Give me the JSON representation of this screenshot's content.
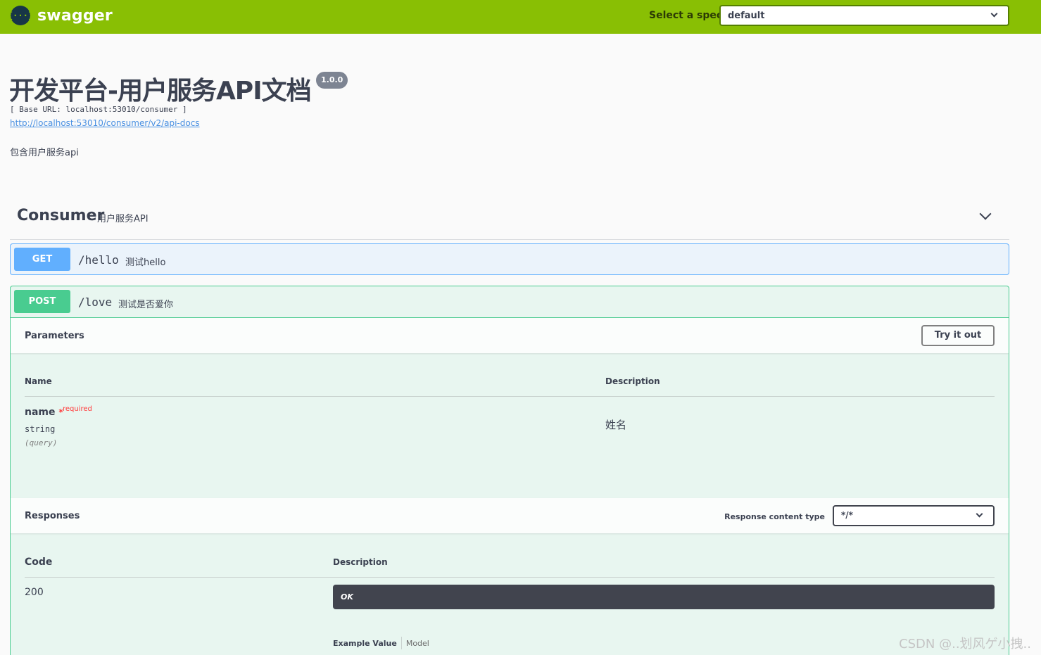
{
  "topbar": {
    "logo_text": "swagger",
    "logo_icon": "{···}",
    "spec_label": "Select a spec",
    "spec_value": "default"
  },
  "info": {
    "title": "开发平台-用户服务API文档",
    "version": "1.0.0",
    "base_url": "[ Base URL: localhost:53010/consumer ]",
    "doc_link": "http://localhost:53010/consumer/v2/api-docs",
    "description": "包含用户服务api"
  },
  "tag": {
    "name": "Consumer",
    "description": "用户服务API"
  },
  "operations": [
    {
      "method": "GET",
      "path": "/hello",
      "summary": "测试hello"
    },
    {
      "method": "POST",
      "path": "/love",
      "summary": "测试是否爱你"
    }
  ],
  "parameters": {
    "header": "Parameters",
    "try_button": "Try it out",
    "col_name": "Name",
    "col_description": "Description",
    "items": [
      {
        "name": "name",
        "star": "*",
        "required": "required",
        "type": "string",
        "in": "(query)",
        "description": "姓名"
      }
    ]
  },
  "responses": {
    "header": "Responses",
    "content_type_label": "Response content type",
    "content_type_value": "*/*",
    "col_code": "Code",
    "col_description": "Description",
    "items": [
      {
        "code": "200",
        "description": "OK"
      }
    ],
    "tab_example": "Example Value",
    "tab_model": "Model"
  },
  "watermark": "CSDN @..划风ゲ小拽..",
  "colors": {
    "topbar": "#89bf04",
    "get": "#61affe",
    "post": "#49cc90",
    "required": "#ff3a3a"
  }
}
